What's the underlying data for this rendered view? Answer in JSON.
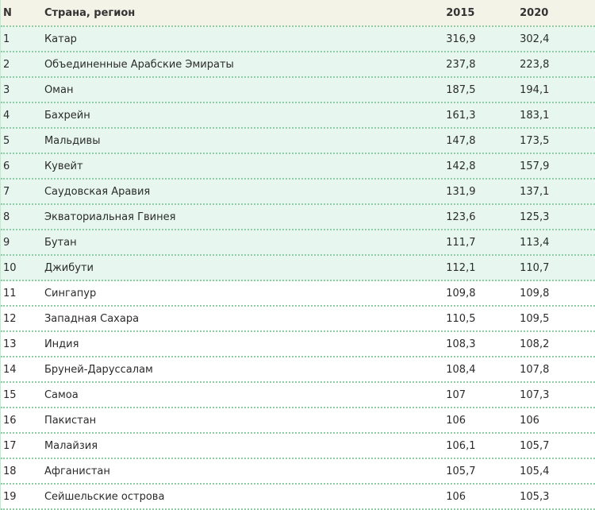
{
  "table": {
    "columns": {
      "n": "N",
      "country": "Страна, регион",
      "y2015": "2015",
      "y2020": "2020"
    },
    "rows": [
      {
        "n": "1",
        "country": "Катар",
        "y2015": "316,9",
        "y2020": "302,4",
        "highlight": true
      },
      {
        "n": "2",
        "country": "Объединенные Арабские Эмираты",
        "y2015": "237,8",
        "y2020": "223,8",
        "highlight": true
      },
      {
        "n": "3",
        "country": "Оман",
        "y2015": "187,5",
        "y2020": "194,1",
        "highlight": true
      },
      {
        "n": "4",
        "country": "Бахрейн",
        "y2015": "161,3",
        "y2020": "183,1",
        "highlight": true
      },
      {
        "n": "5",
        "country": "Мальдивы",
        "y2015": "147,8",
        "y2020": "173,5",
        "highlight": true
      },
      {
        "n": "6",
        "country": "Кувейт",
        "y2015": "142,8",
        "y2020": "157,9",
        "highlight": true
      },
      {
        "n": "7",
        "country": "Саудовская Аравия",
        "y2015": "131,9",
        "y2020": "137,1",
        "highlight": true
      },
      {
        "n": "8",
        "country": "Экваториальная Гвинея",
        "y2015": "123,6",
        "y2020": "125,3",
        "highlight": true
      },
      {
        "n": "9",
        "country": "Бутан",
        "y2015": "111,7",
        "y2020": "113,4",
        "highlight": true
      },
      {
        "n": "10",
        "country": "Джибути",
        "y2015": "112,1",
        "y2020": "110,7",
        "highlight": true
      },
      {
        "n": "11",
        "country": "Сингапур",
        "y2015": "109,8",
        "y2020": "109,8",
        "highlight": false
      },
      {
        "n": "12",
        "country": "Западная Сахара",
        "y2015": "110,5",
        "y2020": "109,5",
        "highlight": false
      },
      {
        "n": "13",
        "country": "Индия",
        "y2015": "108,3",
        "y2020": "108,2",
        "highlight": false
      },
      {
        "n": "14",
        "country": "Бруней-Даруссалам",
        "y2015": "108,4",
        "y2020": "107,8",
        "highlight": false
      },
      {
        "n": "15",
        "country": "Самоа",
        "y2015": "107",
        "y2020": "107,3",
        "highlight": false
      },
      {
        "n": "16",
        "country": "Пакистан",
        "y2015": "106",
        "y2020": "106",
        "highlight": false
      },
      {
        "n": "17",
        "country": "Малайзия",
        "y2015": "106,1",
        "y2020": "105,7",
        "highlight": false
      },
      {
        "n": "18",
        "country": "Афганистан",
        "y2015": "105,7",
        "y2020": "105,4",
        "highlight": false
      },
      {
        "n": "19",
        "country": "Сейшельские острова",
        "y2015": "106",
        "y2020": "105,3",
        "highlight": false
      }
    ]
  },
  "colors": {
    "header_bg": "#f3f3e8",
    "highlight_bg": "#e7f7ef",
    "border_dots": "#8fcba4"
  }
}
